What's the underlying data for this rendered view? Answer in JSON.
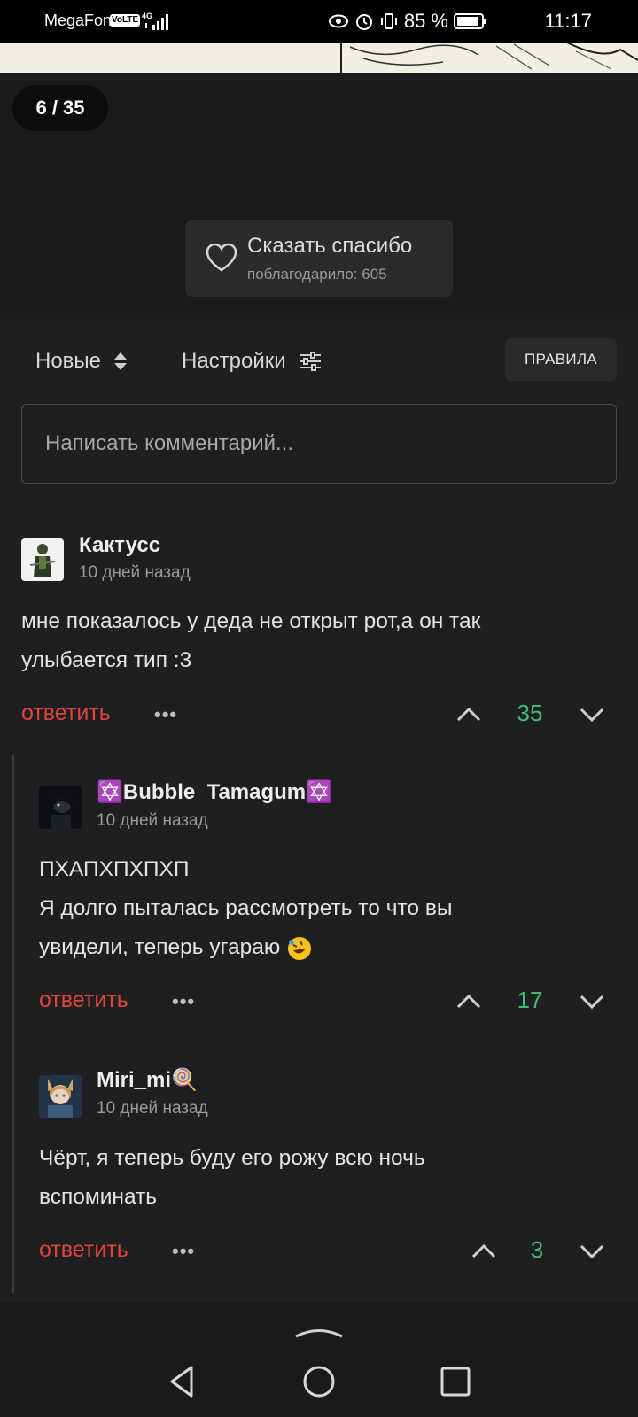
{
  "status_bar": {
    "carrier": "MegaFon",
    "volte": "VoLTE",
    "network": "4G",
    "battery": "85 %",
    "time": "11:17"
  },
  "viewer": {
    "page_counter": "6 / 35",
    "thanks_title": "Сказать спасибо",
    "thanks_count": "поблагодарило: 605"
  },
  "controls": {
    "sort_label": "Новые",
    "settings_label": "Настройки",
    "rules_label": "ПРАВИЛА",
    "comment_placeholder": "Написать комментарий..."
  },
  "comments": [
    {
      "username": "Кактусс",
      "time": "10 дней назад",
      "lines": [
        "мне показалось у деда не открыт рот,а он так",
        "улыбается тип :3"
      ],
      "reply": "ответить",
      "votes": "35"
    },
    {
      "username_prefix": "✡️",
      "username": "Bubble_Tamagum",
      "username_suffix": "✡️",
      "time": "10 дней назад",
      "lines": [
        "ПХАПХПХПХП",
        "Я долго пыталась рассмотреть то что вы",
        "увидели, теперь угараю"
      ],
      "emoji": "rolling-laughing-emoji",
      "reply": "ответить",
      "votes": "17"
    },
    {
      "username": "Miri_mi",
      "username_suffix": "🍭",
      "time": "10 дней назад",
      "lines": [
        "Чёрт, я теперь буду его рожу всю ночь",
        "вспоминать"
      ],
      "reply": "ответить",
      "votes": "3"
    }
  ],
  "more_label": "•••",
  "colors": {
    "reply_red": "#e0443a",
    "vote_green": "#3fbf72",
    "background": "#1f1f21"
  }
}
